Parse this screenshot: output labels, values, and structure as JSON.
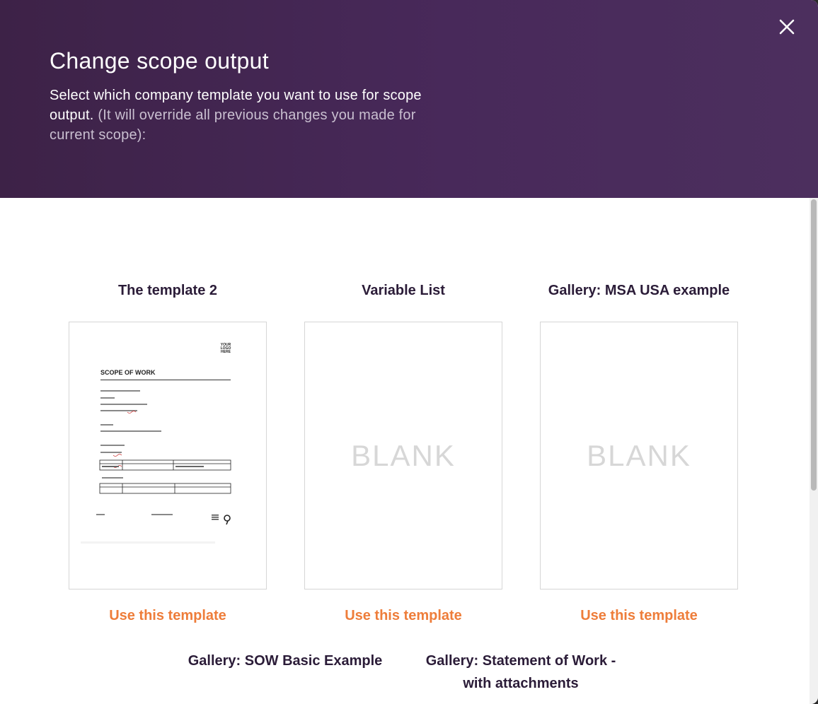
{
  "modal": {
    "title": "Change scope output",
    "subtitle_main": "Select which company template you want to use for scope output.",
    "subtitle_note": "(It will override all previous changes you made for current scope):",
    "close_icon": "close-icon"
  },
  "templates": [
    {
      "name": "The template 2",
      "preview": "scope-of-work",
      "action": "Use this template"
    },
    {
      "name": "Variable List",
      "preview_text": "BLANK",
      "action": "Use this template"
    },
    {
      "name": "Gallery: MSA USA example",
      "preview_text": "BLANK",
      "action": "Use this template"
    }
  ],
  "templates_more": [
    {
      "name": "Gallery: SOW Basic Example"
    },
    {
      "name": "Gallery: Statement of Work - with attachments"
    }
  ],
  "preview_doc": {
    "logo": "YOUR LOGO HERE",
    "heading": "SCOPE OF WORK"
  },
  "colors": {
    "header": "#46285a",
    "title_text": "#2b1c38",
    "link": "#ee7d3a"
  }
}
